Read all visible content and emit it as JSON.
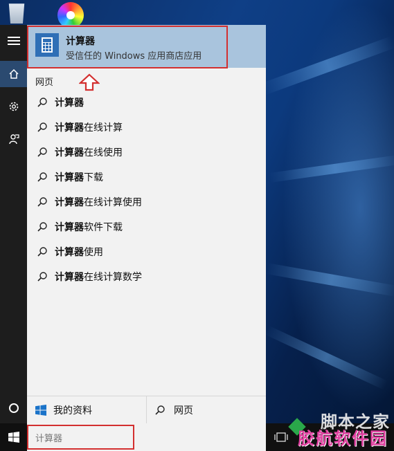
{
  "best_match": {
    "title": "计算器",
    "subtitle": "受信任的 Windows 应用商店应用"
  },
  "section_label": "网页",
  "suggestions": [
    {
      "query": "计算器",
      "rest": ""
    },
    {
      "query": "计算器",
      "rest": "在线计算"
    },
    {
      "query": "计算器",
      "rest": "在线使用"
    },
    {
      "query": "计算器",
      "rest": "下载"
    },
    {
      "query": "计算器",
      "rest": "在线计算使用"
    },
    {
      "query": "计算器",
      "rest": "软件下载"
    },
    {
      "query": "计算器",
      "rest": "使用"
    },
    {
      "query": "计算器",
      "rest": "在线计算数学"
    }
  ],
  "bottom": {
    "my_stuff_label": "我的资料",
    "web_label": "网页"
  },
  "taskbar": {
    "search_text": "计算器"
  },
  "watermark": {
    "site_text": "脚本之家",
    "brand_text": "胶航软件园"
  },
  "icons": {
    "menu": "hamburger-icon",
    "home": "home-icon",
    "settings": "gear-icon",
    "feedback": "feedback-icon",
    "cortana": "cortana-circle-icon",
    "start": "windows-logo-icon",
    "search": "magnifier-icon"
  },
  "colors": {
    "accent": "#2f6fb6",
    "highlight_box": "#d32f2f",
    "selected_bg": "#a9c4dd"
  }
}
